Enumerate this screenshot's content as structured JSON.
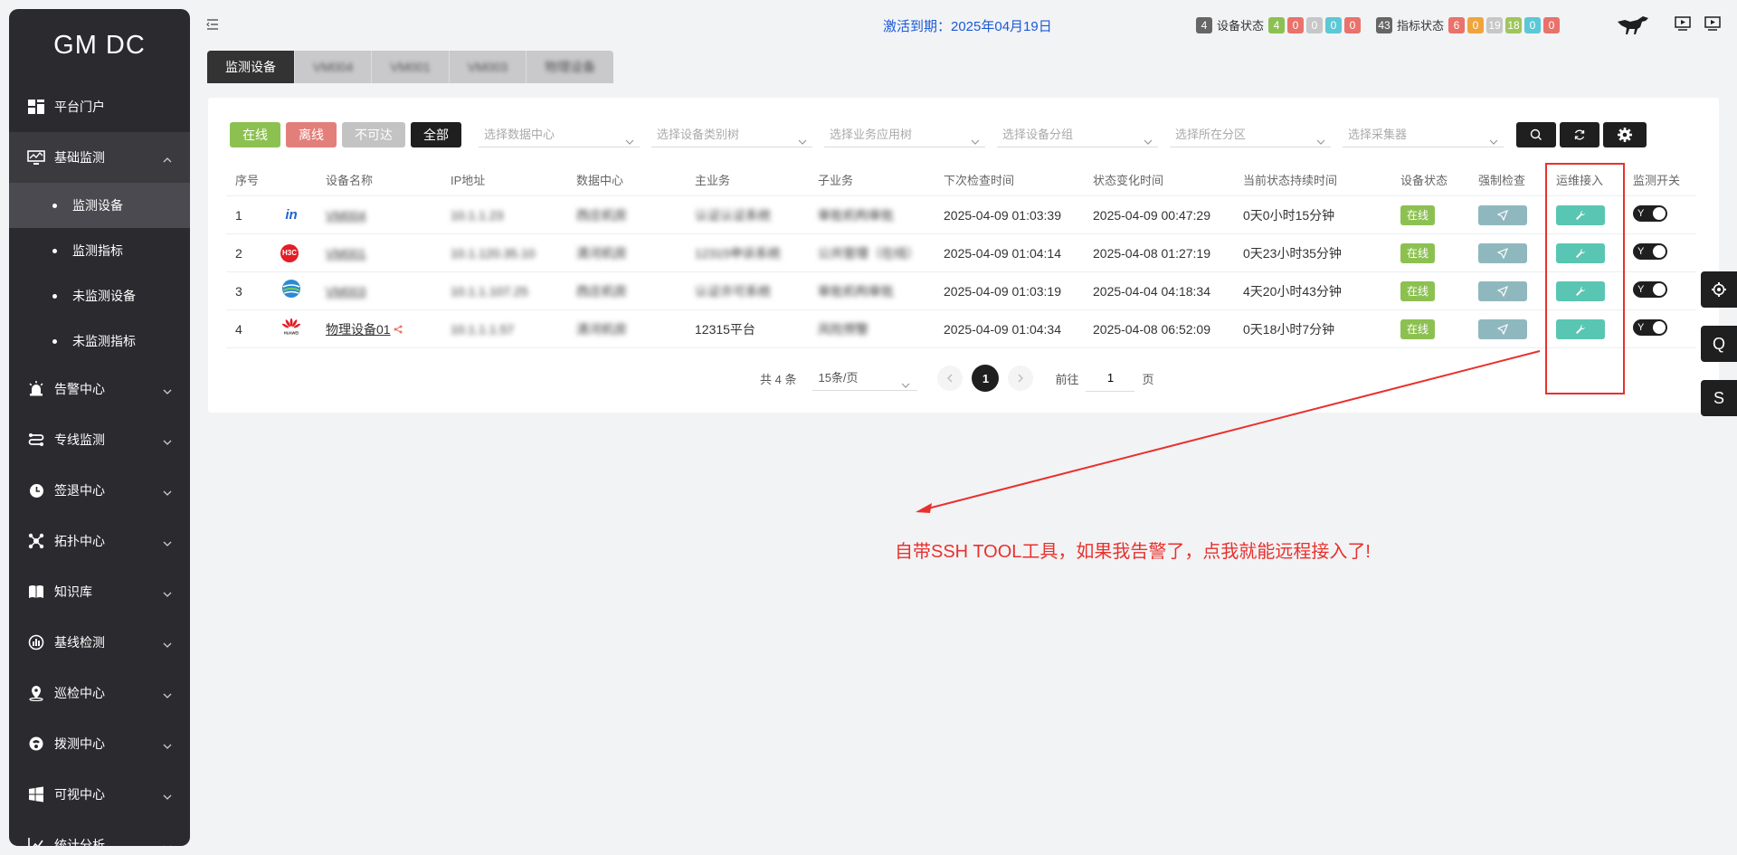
{
  "app": {
    "brand": "GM DC"
  },
  "sidebar": {
    "items": [
      {
        "label": "平台门户",
        "icon": "dashboard-icon"
      },
      {
        "label": "基础监测",
        "icon": "monitor-icon",
        "open": true,
        "children": [
          {
            "label": "监测设备",
            "active": true
          },
          {
            "label": "监测指标"
          },
          {
            "label": "未监测设备"
          },
          {
            "label": "未监测指标"
          }
        ]
      },
      {
        "label": "告警中心",
        "icon": "alarm-icon"
      },
      {
        "label": "专线监测",
        "icon": "line-icon"
      },
      {
        "label": "签退中心",
        "icon": "clock-icon"
      },
      {
        "label": "拓扑中心",
        "icon": "topology-icon"
      },
      {
        "label": "知识库",
        "icon": "book-icon"
      },
      {
        "label": "基线检测",
        "icon": "baseline-icon"
      },
      {
        "label": "巡检中心",
        "icon": "location-icon"
      },
      {
        "label": "拨测中心",
        "icon": "dial-icon"
      },
      {
        "label": "可视中心",
        "icon": "windows-icon"
      },
      {
        "label": "统计分析",
        "icon": "stats-icon"
      }
    ]
  },
  "header": {
    "expire": "激活到期：2025年04月19日",
    "device_status": {
      "count": "4",
      "label": "设备状态",
      "values": [
        "4",
        "0",
        "0",
        "0",
        "0"
      ]
    },
    "metric_status": {
      "count": "43",
      "label": "指标状态",
      "values": [
        "6",
        "0",
        "19",
        "18",
        "0",
        "0"
      ]
    }
  },
  "tabs": [
    "监测设备",
    "VM004",
    "VM001",
    "VM003",
    "物理设备"
  ],
  "filters": {
    "status_buttons": [
      "在线",
      "离线",
      "不可达",
      "全部"
    ],
    "selects": [
      "选择数据中心",
      "选择设备类别树",
      "选择业务应用树",
      "选择设备分组",
      "选择所在分区",
      "选择采集器"
    ]
  },
  "table": {
    "columns": [
      "序号",
      "",
      "设备名称",
      "IP地址",
      "数据中心",
      "主业务",
      "子业务",
      "下次检查时间",
      "状态变化时间",
      "当前状态持续时间",
      "设备状态",
      "强制检查",
      "运维接入",
      "监测开关"
    ],
    "rows": [
      {
        "no": "1",
        "logo": "in",
        "name": "VM004",
        "ip": "10.1.1.23",
        "dc": "西庄机房",
        "main": "认证认证系统",
        "sub": "审批机构审批",
        "next": "2025-04-09 01:03:39",
        "changed": "2025-04-09 00:47:29",
        "duration": "0天0小时15分钟",
        "status": "在线",
        "toggle": "Y"
      },
      {
        "no": "2",
        "logo": "H3C",
        "name": "VM001",
        "ip": "10.1.120.35.10",
        "dc": "清河机房",
        "main": "12315申诉系统",
        "sub": "公共管理（在线）",
        "next": "2025-04-09 01:04:14",
        "changed": "2025-04-08 01:27:19",
        "duration": "0天23小时35分钟",
        "status": "在线",
        "toggle": "Y"
      },
      {
        "no": "3",
        "logo": "globe",
        "name": "VM003",
        "ip": "10.1.1.107.25",
        "dc": "西庄机房",
        "main": "认证许可系统",
        "sub": "审批机构审批",
        "next": "2025-04-09 01:03:19",
        "changed": "2025-04-04 04:18:34",
        "duration": "4天20小时43分钟",
        "status": "在线",
        "toggle": "Y"
      },
      {
        "no": "4",
        "logo": "HUAWEI",
        "name": "物理设备01",
        "ip": "10.1.1.1.57",
        "dc": "清河机房",
        "main": "12315平台",
        "sub": "风险预警",
        "next": "2025-04-09 01:04:34",
        "changed": "2025-04-08 06:52:09",
        "duration": "0天18小时7分钟",
        "status": "在线",
        "toggle": "Y"
      }
    ]
  },
  "pager": {
    "total": "共 4 条",
    "page_size": "15条/页",
    "current": "1",
    "goto_label": "前往",
    "goto_value": "1",
    "page_unit": "页"
  },
  "annotation": "自带SSH TOOL工具，如果我告警了，点我就能远程接入了!",
  "float_buttons": [
    "settings",
    "Q",
    "S"
  ],
  "colors": {
    "online": "#8cc152",
    "offline": "#e37f7b",
    "ops": "#59c6b3",
    "annotation": "#e8312d"
  }
}
